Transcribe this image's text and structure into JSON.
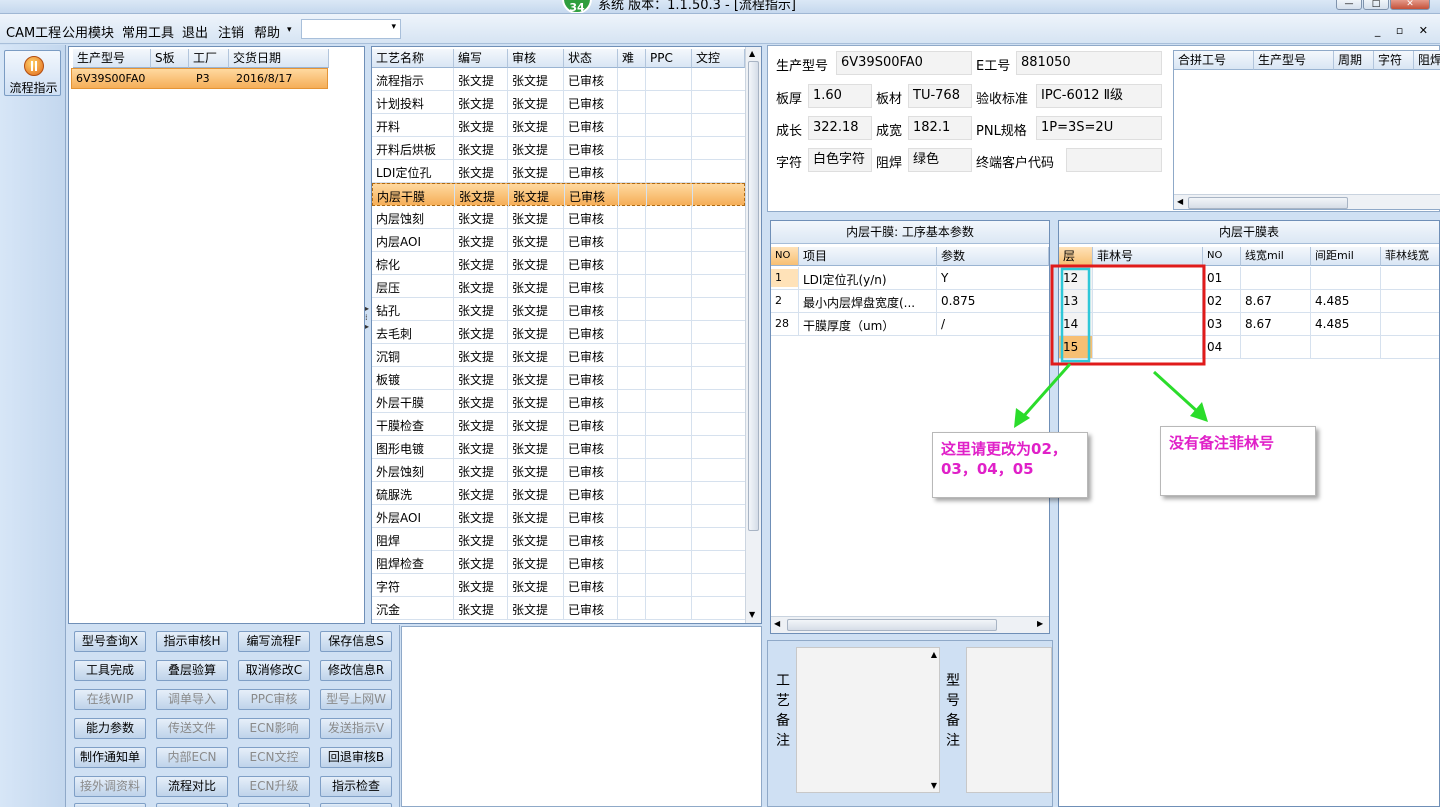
{
  "title": {
    "badge": "34",
    "text": "系统   版本：1.1.50.3 - [流程指示]"
  },
  "menu": {
    "items": [
      "CAM工程",
      "公用模块",
      "常用工具",
      "退出",
      "注销",
      "帮助"
    ],
    "combo_value": ""
  },
  "nav": {
    "label": "流程指示"
  },
  "model_list": {
    "headers": [
      "生产型号",
      "S板",
      "工厂",
      "交货日期"
    ],
    "rows": [
      [
        "6V39S00FA0",
        "",
        "P3",
        "2016/8/17"
      ]
    ]
  },
  "process_grid": {
    "headers": [
      "工艺名称",
      "编写",
      "审核",
      "状态",
      "难",
      "PPC",
      "文控"
    ],
    "rows": [
      [
        "流程指示",
        "张文提",
        "张文提",
        "已审核"
      ],
      [
        "计划投料",
        "张文提",
        "张文提",
        "已审核"
      ],
      [
        "开料",
        "张文提",
        "张文提",
        "已审核"
      ],
      [
        "开料后烘板",
        "张文提",
        "张文提",
        "已审核"
      ],
      [
        "LDI定位孔",
        "张文提",
        "张文提",
        "已审核"
      ],
      [
        "内层干膜",
        "张文提",
        "张文提",
        "已审核"
      ],
      [
        "内层蚀刻",
        "张文提",
        "张文提",
        "已审核"
      ],
      [
        "内层AOI",
        "张文提",
        "张文提",
        "已审核"
      ],
      [
        "棕化",
        "张文提",
        "张文提",
        "已审核"
      ],
      [
        "层压",
        "张文提",
        "张文提",
        "已审核"
      ],
      [
        "钻孔",
        "张文提",
        "张文提",
        "已审核"
      ],
      [
        "去毛刺",
        "张文提",
        "张文提",
        "已审核"
      ],
      [
        "沉铜",
        "张文提",
        "张文提",
        "已审核"
      ],
      [
        "板镀",
        "张文提",
        "张文提",
        "已审核"
      ],
      [
        "外层干膜",
        "张文提",
        "张文提",
        "已审核"
      ],
      [
        "干膜检查",
        "张文提",
        "张文提",
        "已审核"
      ],
      [
        "图形电镀",
        "张文提",
        "张文提",
        "已审核"
      ],
      [
        "外层蚀刻",
        "张文提",
        "张文提",
        "已审核"
      ],
      [
        "硫脲洗",
        "张文提",
        "张文提",
        "已审核"
      ],
      [
        "外层AOI",
        "张文提",
        "张文提",
        "已审核"
      ],
      [
        "阻焊",
        "张文提",
        "张文提",
        "已审核"
      ],
      [
        "阻焊检查",
        "张文提",
        "张文提",
        "已审核"
      ],
      [
        "字符",
        "张文提",
        "张文提",
        "已审核"
      ],
      [
        "沉金",
        "张文提",
        "张文提",
        "已审核"
      ]
    ]
  },
  "buttons": [
    {
      "label": "型号查询X",
      "enabled": true
    },
    {
      "label": "指示审核H",
      "enabled": true
    },
    {
      "label": "编写流程F",
      "enabled": true
    },
    {
      "label": "保存信息S",
      "enabled": true
    },
    {
      "label": "工具完成",
      "enabled": true
    },
    {
      "label": "叠层验算",
      "enabled": true
    },
    {
      "label": "取消修改C",
      "enabled": true
    },
    {
      "label": "修改信息R",
      "enabled": true
    },
    {
      "label": "在线WIP",
      "enabled": false
    },
    {
      "label": "调单导入",
      "enabled": false
    },
    {
      "label": "PPC审核",
      "enabled": false
    },
    {
      "label": "型号上网W",
      "enabled": false
    },
    {
      "label": "能力参数",
      "enabled": true
    },
    {
      "label": "传送文件",
      "enabled": false
    },
    {
      "label": "ECN影响",
      "enabled": false
    },
    {
      "label": "发送指示V",
      "enabled": false
    },
    {
      "label": "制作通知单",
      "enabled": true
    },
    {
      "label": "内部ECN",
      "enabled": false
    },
    {
      "label": "ECN文控",
      "enabled": false
    },
    {
      "label": "回退审核B",
      "enabled": true
    },
    {
      "label": "接外调资料",
      "enabled": false
    },
    {
      "label": "流程对比",
      "enabled": true
    },
    {
      "label": "ECN升级",
      "enabled": false
    },
    {
      "label": "指示检查",
      "enabled": true
    }
  ],
  "info": {
    "model_label": "生产型号",
    "model": "6V39S00FA0",
    "eno_label": "E工号",
    "eno": "881050",
    "thick_label": "板厚",
    "thick": "1.60",
    "mat_label": "板材",
    "mat": "TU-768",
    "std_label": "验收标准",
    "std": "IPC-6012 Ⅱ级",
    "len_label": "成长",
    "len": "322.18",
    "wid_label": "成宽",
    "wid": "182.1",
    "pnl_label": "PNL规格",
    "pnl": "1P=3S=2U",
    "char_label": "字符",
    "char": "白色字符",
    "mask_label": "阻焊",
    "mask": "绿色",
    "cust_label": "终端客户代码",
    "cust": ""
  },
  "merge_grid": {
    "headers": [
      "合拼工号",
      "生产型号",
      "周期",
      "字符",
      "阻焊"
    ]
  },
  "params": {
    "title": "内层干膜: 工序基本参数",
    "headers": [
      "NO",
      "项目",
      "参数"
    ],
    "rows": [
      [
        "1",
        "LDI定位孔(y/n)",
        "Y"
      ],
      [
        "2",
        "最小内层焊盘宽度(...",
        "0.875"
      ],
      [
        "28",
        "干膜厚度（um）",
        "/"
      ]
    ]
  },
  "film_table": {
    "title": "内层干膜表",
    "headers": [
      "层",
      "菲林号",
      "NO",
      "线宽mil",
      "间距mil",
      "菲林线宽"
    ],
    "rows": [
      [
        "12",
        "",
        "01",
        "",
        "",
        ""
      ],
      [
        "13",
        "",
        "02",
        "8.67",
        "4.485",
        ""
      ],
      [
        "14",
        "",
        "03",
        "8.67",
        "4.485",
        ""
      ],
      [
        "15",
        "",
        "04",
        "",
        "",
        ""
      ]
    ]
  },
  "remarks": {
    "process_label": "工艺备注",
    "model_label": "型号备注"
  },
  "annotations": {
    "note1": "这里请更改为02，03，04，05",
    "note2": "没有备注菲林号",
    "box_color": "#e01b1b",
    "highlight_color": "#2ec7d8",
    "arrow_color": "#2bdc2b",
    "text_color": "#e020c8"
  }
}
